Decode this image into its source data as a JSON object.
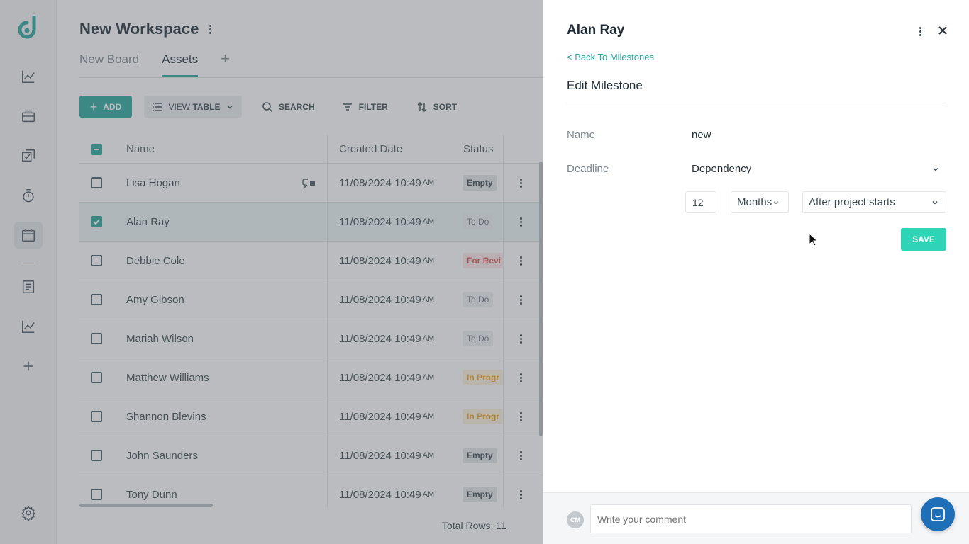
{
  "colors": {
    "accent": "#26a69a",
    "save": "#2ed4b5",
    "overlay": "rgba(90,96,102,0.42)",
    "chat": "#1e6fb8"
  },
  "rail": {
    "icons": [
      "logo-icon",
      "analytics-icon",
      "briefcase-icon",
      "tasks-icon",
      "timer-icon",
      "calendar-icon",
      "document-icon",
      "reports-icon",
      "add-icon",
      "settings-icon"
    ],
    "active": "calendar-icon"
  },
  "workspace": {
    "title": "New Workspace",
    "tabs": [
      {
        "label": "New Board",
        "active": false
      },
      {
        "label": "Assets",
        "active": true
      }
    ],
    "toolbar": {
      "add_label": "ADD",
      "view_prefix": "VIEW",
      "view_label": "TABLE",
      "search_label": "SEARCH",
      "filter_label": "FILTER",
      "sort_label": "SORT"
    },
    "table": {
      "columns": [
        "Name",
        "Created Date",
        "Status"
      ],
      "rows": [
        {
          "name": "Lisa Hogan",
          "date": "11/08/2024 10:49",
          "ampm": "AM",
          "status": "Empty",
          "status_type": "empty",
          "checked": false,
          "has_icon": true
        },
        {
          "name": "Alan Ray",
          "date": "11/08/2024 10:49",
          "ampm": "AM",
          "status": "To Do",
          "status_type": "todo",
          "checked": true,
          "has_icon": false
        },
        {
          "name": "Debbie Cole",
          "date": "11/08/2024 10:49",
          "ampm": "AM",
          "status": "For Revi",
          "status_type": "review",
          "checked": false,
          "has_icon": false
        },
        {
          "name": "Amy Gibson",
          "date": "11/08/2024 10:49",
          "ampm": "AM",
          "status": "To Do",
          "status_type": "todo",
          "checked": false,
          "has_icon": false
        },
        {
          "name": "Mariah Wilson",
          "date": "11/08/2024 10:49",
          "ampm": "AM",
          "status": "To Do",
          "status_type": "todo",
          "checked": false,
          "has_icon": false
        },
        {
          "name": "Matthew Williams",
          "date": "11/08/2024 10:49",
          "ampm": "AM",
          "status": "In Progr",
          "status_type": "progress",
          "checked": false,
          "has_icon": false
        },
        {
          "name": "Shannon Blevins",
          "date": "11/08/2024 10:49",
          "ampm": "AM",
          "status": "In Progr",
          "status_type": "progress",
          "checked": false,
          "has_icon": false
        },
        {
          "name": "John Saunders",
          "date": "11/08/2024 10:49",
          "ampm": "AM",
          "status": "Empty",
          "status_type": "empty",
          "checked": false,
          "has_icon": false
        },
        {
          "name": "Tony Dunn",
          "date": "11/08/2024 10:49",
          "ampm": "AM",
          "status": "Empty",
          "status_type": "empty",
          "checked": false,
          "has_icon": false
        }
      ],
      "total_rows_label": "Total Rows: 11"
    }
  },
  "drawer": {
    "title": "Alan Ray",
    "back_label": "< Back To Milestones",
    "section_title": "Edit Milestone",
    "fields": {
      "name_label": "Name",
      "name_value": "new",
      "deadline_label": "Deadline",
      "deadline_value": "Dependency",
      "amount": "12",
      "unit": "Months",
      "relation": "After project starts"
    },
    "save_label": "SAVE",
    "comment": {
      "avatar_initials": "CM",
      "placeholder": "Write your comment"
    }
  }
}
